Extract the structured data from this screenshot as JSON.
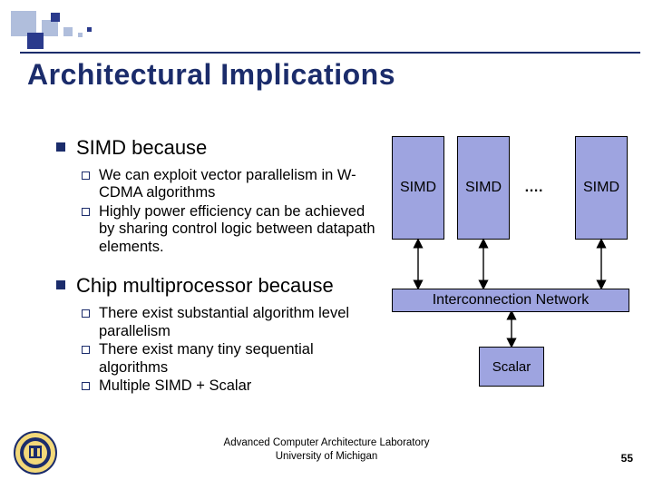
{
  "title": "Architectural Implications",
  "bullets": {
    "b1": {
      "label": "SIMD because",
      "sub": [
        "We can exploit vector parallelism in W-CDMA algorithms",
        "Highly power efficiency can be achieved by sharing control logic between datapath elements."
      ]
    },
    "b2": {
      "label": "Chip multiprocessor because",
      "sub": [
        "There exist substantial algorithm level parallelism",
        "There exist many tiny sequential algorithms",
        "Multiple SIMD + Scalar"
      ]
    }
  },
  "diagram": {
    "simd_label": "SIMD",
    "dots": "….",
    "network": "Interconnection Network",
    "scalar": "Scalar"
  },
  "footer": {
    "line1": "Advanced Computer Architecture Laboratory",
    "line2": "University of Michigan"
  },
  "page_number": "55"
}
